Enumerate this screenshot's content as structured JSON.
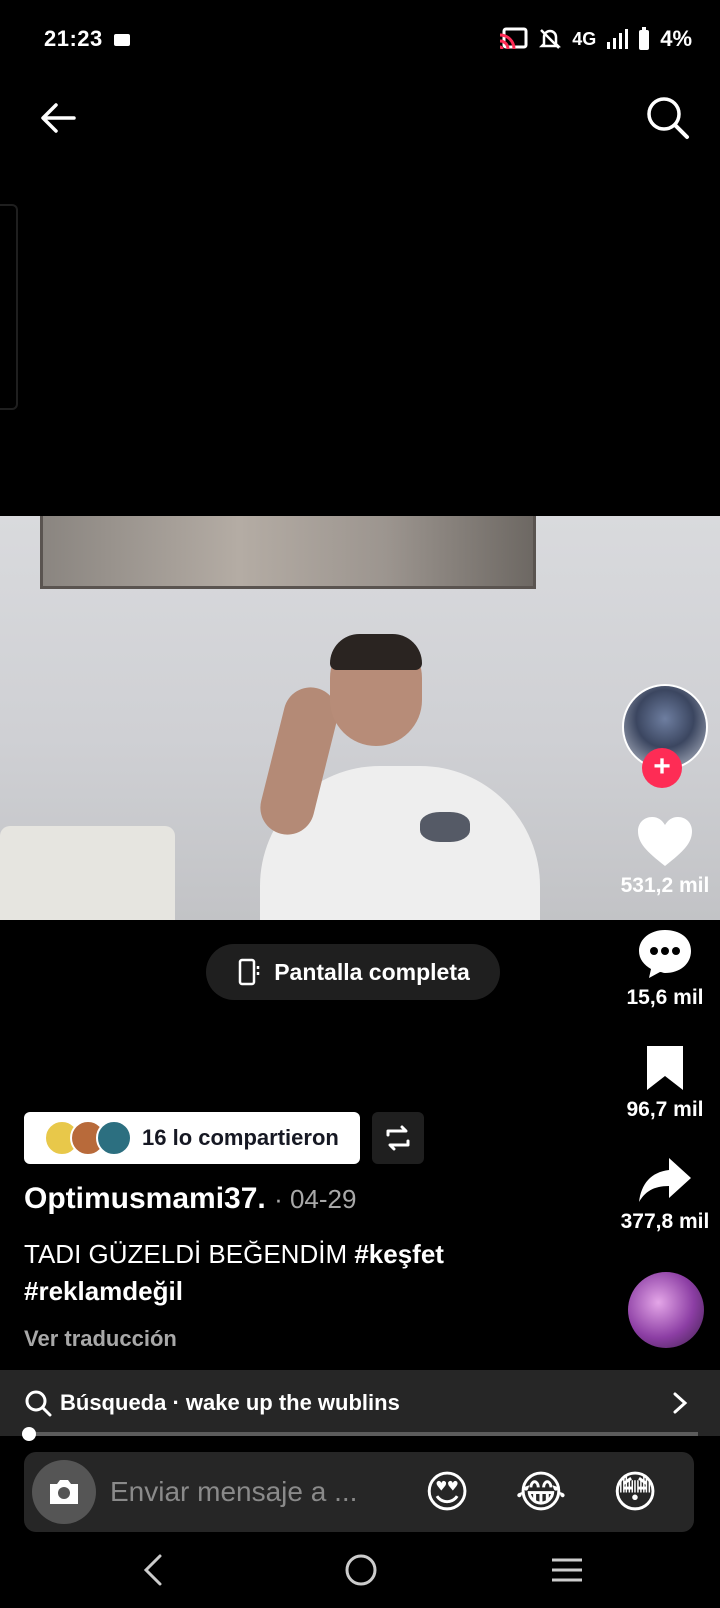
{
  "status_bar": {
    "time": "21:23",
    "network": "4G",
    "battery": "4%"
  },
  "video": {
    "fullscreen_label": "Pantalla completa"
  },
  "actions": {
    "likes": "531,2 mil",
    "comments": "15,6 mil",
    "saves": "96,7 mil",
    "shares": "377,8 mil",
    "follow_symbol": "+"
  },
  "post": {
    "shared_label": "16 lo compartieron",
    "author": "Optimusmami37.",
    "date": "· 04-29",
    "caption_text": "TADI GÜZELDİ BEĞENDİM ",
    "hashtags": [
      "#keşfet",
      "#reklamdeğil"
    ],
    "translate_label": "Ver traducción"
  },
  "search_suggestion": {
    "label": "Búsqueda · wake up the wublins"
  },
  "progress": {
    "value": 0.0
  },
  "comment_bar": {
    "placeholder": "Enviar mensaje a ...",
    "emojis": [
      "😍",
      "😂",
      "😳"
    ]
  },
  "colors": {
    "accent": "#fe2c55",
    "background": "#000000",
    "panel": "#262626"
  }
}
